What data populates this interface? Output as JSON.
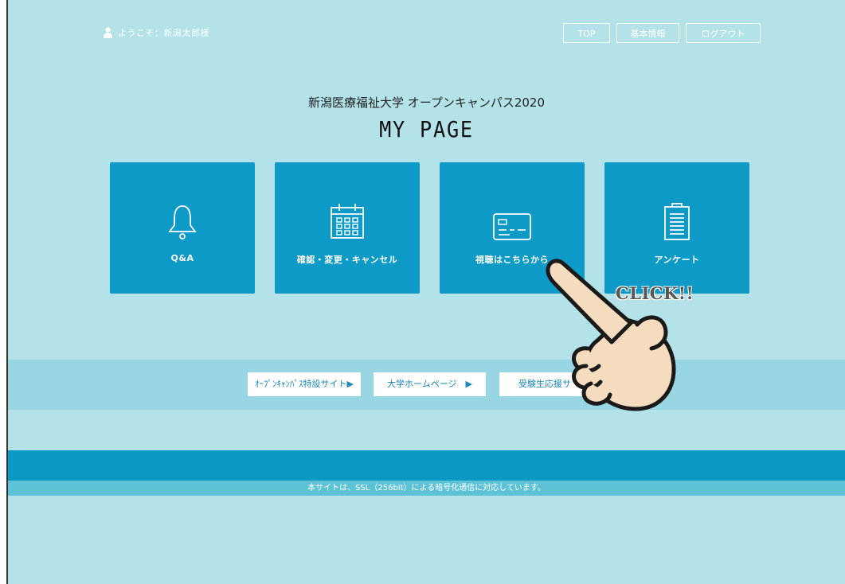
{
  "header": {
    "welcome_text": "ようこそ：新潟太郎様",
    "nav": [
      "TOP",
      "基本情報",
      "ログアウト"
    ]
  },
  "main": {
    "subtitle": "新潟医療福祉大学 オープンキャンパス2020",
    "title": "MY PAGE",
    "tiles": [
      {
        "label": "Q&A",
        "icon": "bell-icon"
      },
      {
        "label": "確認・変更・キャンセル",
        "icon": "calendar-icon"
      },
      {
        "label": "視聴はこちらから",
        "icon": "card-icon"
      },
      {
        "label": "アンケート",
        "icon": "clipboard-icon"
      }
    ]
  },
  "links": [
    {
      "label": "ｵｰﾌﾟﾝｷｬﾝﾊﾟｽ特設サイト▶"
    },
    {
      "label": "大学ホームページ　▶"
    },
    {
      "label": "受験生応援サ"
    }
  ],
  "footer": {
    "ssl_text": "本サイトは、SSL（256bit）による暗号化通信に対応しています。"
  },
  "overlay": {
    "click_text": "CLICK!!",
    "icon": "pointing-hand-icon"
  },
  "colors": {
    "background": "#b3e2e8",
    "tile": "#0e9ac6",
    "band": "#98d6e4",
    "footer": "#0c98c5",
    "link_text": "#1b89b8"
  }
}
